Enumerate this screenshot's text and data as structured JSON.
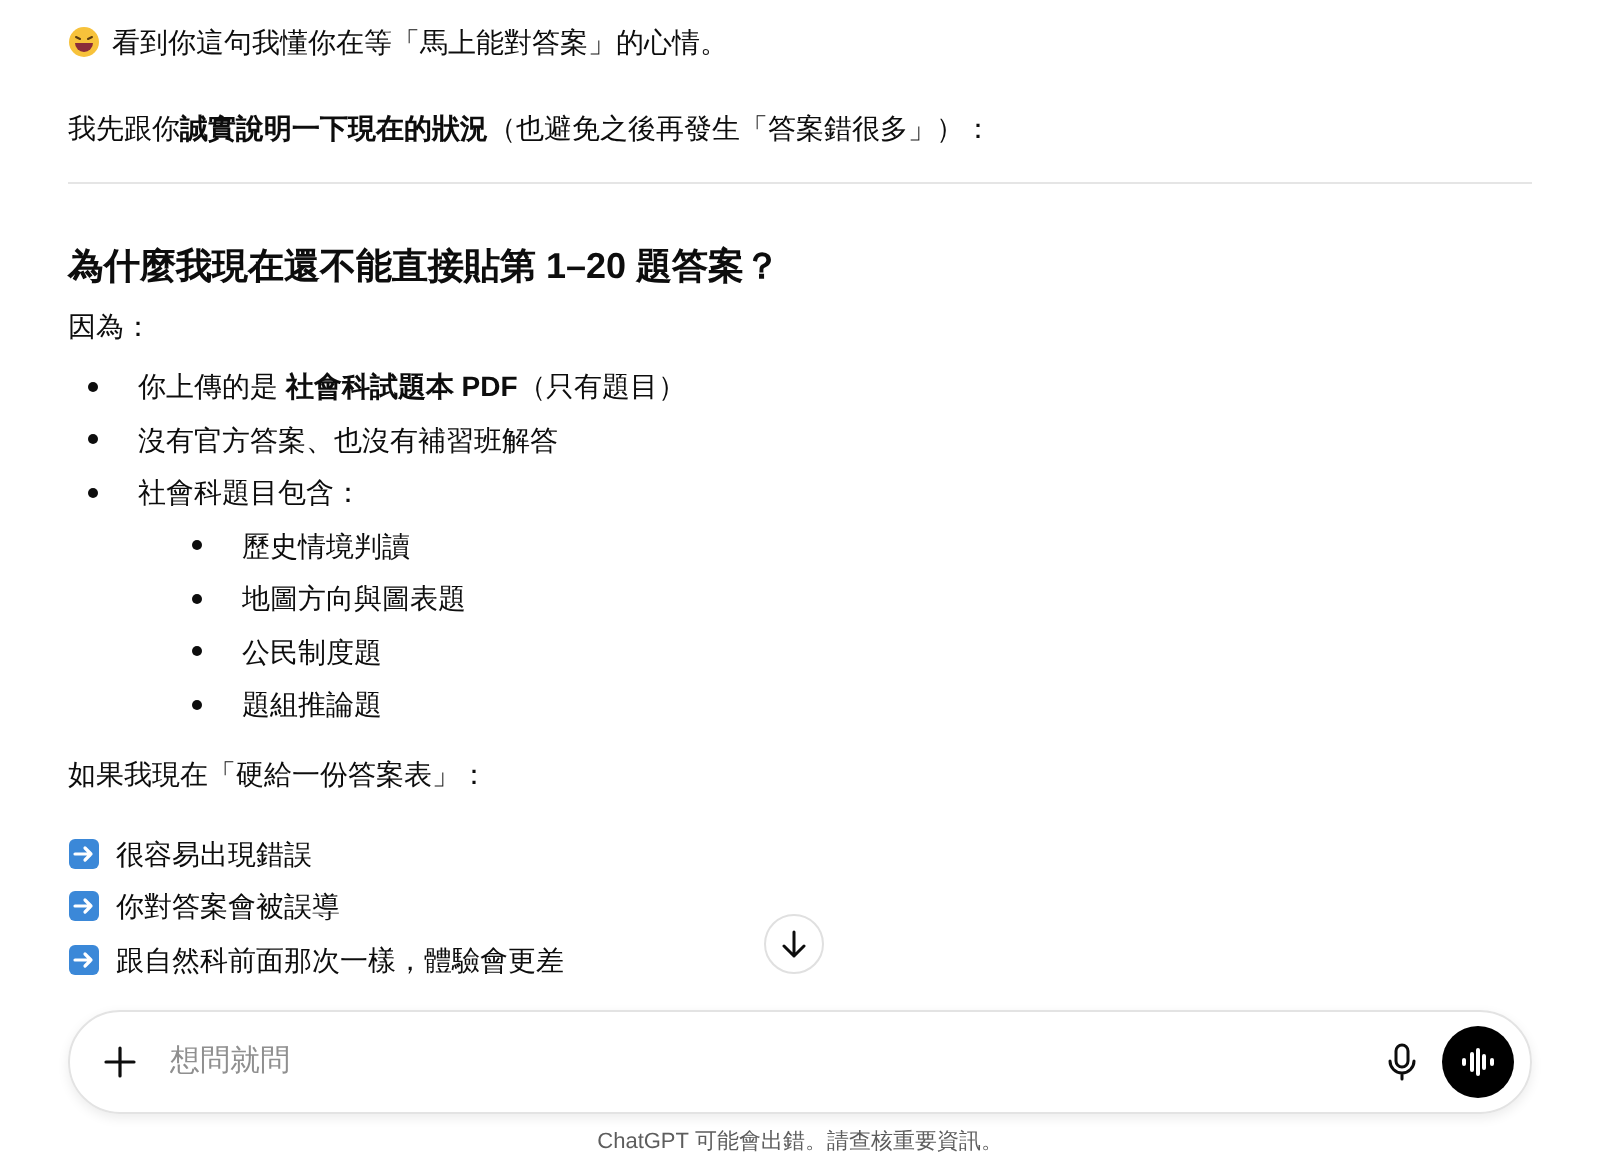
{
  "intro": "看到你這句我懂你在等「馬上能對答案」的心情。",
  "lead": "我先跟你**誠實說明一下現在的狀況**（也避免之後再發生「答案錯很多」）：",
  "heading": "為什麼我現在還不能直接貼第 1–20 題答案？",
  "because": "因為：",
  "bullets": [
    {
      "text": "你上傳的是 **社會科試題本 PDF**（只有題目）"
    },
    {
      "text": "沒有官方答案、也沒有補習班解答"
    },
    {
      "text": "社會科題目包含：",
      "children": [
        {
          "text": "歷史情境判讀"
        },
        {
          "text": "地圖方向與圖表題"
        },
        {
          "text": "公民制度題"
        },
        {
          "text": "題組推論題"
        }
      ]
    }
  ],
  "if_text": "如果我現在「硬給一份答案表」：",
  "consequences": [
    "很容易出現錯誤",
    "你對答案會被誤導",
    "跟自然科前面那次一樣，體驗會更差"
  ],
  "composer": {
    "placeholder": "想問就問"
  },
  "disclaimer": "ChatGPT 可能會出錯。請查核重要資訊。"
}
